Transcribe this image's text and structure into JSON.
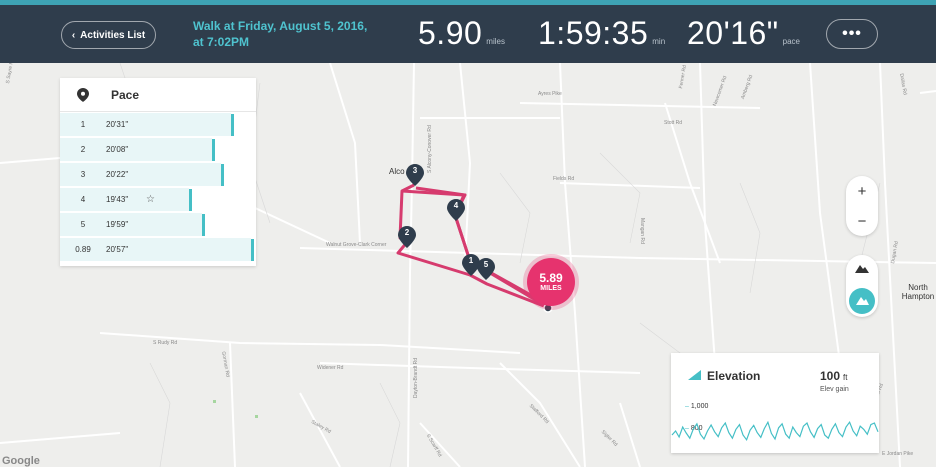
{
  "header": {
    "back_label": "Activities List",
    "title_line1": "Walk at Friday, August 5, 2016,",
    "title_line2": "at 7:02PM",
    "distance": {
      "value": "5.90",
      "unit": "miles"
    },
    "duration": {
      "value": "1:59:35",
      "unit": "min"
    },
    "pace": {
      "value": "20'16\"",
      "unit": "pace"
    },
    "more_label": "•••"
  },
  "pace_panel": {
    "title": "Pace",
    "rows": [
      {
        "mile": "1",
        "pace": "20'31\"",
        "starred": false,
        "fill": 0.86
      },
      {
        "mile": "2",
        "pace": "20'08\"",
        "starred": false,
        "fill": 0.73
      },
      {
        "mile": "3",
        "pace": "20'22\"",
        "starred": false,
        "fill": 0.79
      },
      {
        "mile": "4",
        "pace": "19'43\"",
        "starred": true,
        "fill": 0.57
      },
      {
        "mile": "5",
        "pace": "19'59\"",
        "starred": false,
        "fill": 0.66
      },
      {
        "mile": "0.89",
        "pace": "20'57\"",
        "starred": false,
        "fill": 1.0
      }
    ],
    "star_glyph": "☆"
  },
  "route": {
    "total_value": "5.89",
    "total_unit": "MILES",
    "markers": [
      "1",
      "2",
      "3",
      "4",
      "5"
    ]
  },
  "map_labels": {
    "places": [
      "Alco",
      "North Hampton"
    ],
    "roads": [
      "Ayres Pike",
      "Stott Rd",
      "Fields Rd",
      "S Alcony-Conover Rd",
      "Walnut Grove-Clark Corner",
      "S Rudy Rd",
      "Gorman Rd",
      "Widener Rd",
      "Dayton-Brandt Rd",
      "Stafford Rd",
      "Sigler Rd",
      "S Scarff Rd",
      "Staley Rd",
      "Fenner Rd",
      "Newcomer Rd",
      "Amberg Rd",
      "Mangan Rd",
      "S Sayre Rd",
      "Myers Rd",
      "E Jordan Pike",
      "Dallas Rd",
      "Dugan Rd"
    ]
  },
  "zoom": {
    "in": "+",
    "out": "−"
  },
  "elevation": {
    "title": "Elevation",
    "gain_value": "100",
    "gain_unit": "ft",
    "gain_label": "Elev gain",
    "ticks": [
      "1,000",
      "800"
    ],
    "profile": [
      820,
      830,
      815,
      840,
      825,
      812,
      835,
      848,
      822,
      810,
      830,
      845,
      828,
      816,
      838,
      850,
      826,
      812,
      834,
      846,
      820,
      808,
      832,
      844,
      826,
      814,
      836,
      852,
      824,
      810,
      838,
      848,
      822,
      812,
      840,
      826,
      816,
      842,
      850,
      828,
      814,
      836,
      846,
      820,
      812,
      834,
      848,
      826,
      816,
      840,
      852,
      830,
      818,
      842,
      834,
      822,
      846,
      850,
      828
    ]
  },
  "footer": {
    "attribution": "Google"
  },
  "colors": {
    "header_bg": "#2f3d4c",
    "accent_teal": "#45bfc6",
    "route_pink": "#e6336e",
    "marker_navy": "#2f3d4c"
  }
}
